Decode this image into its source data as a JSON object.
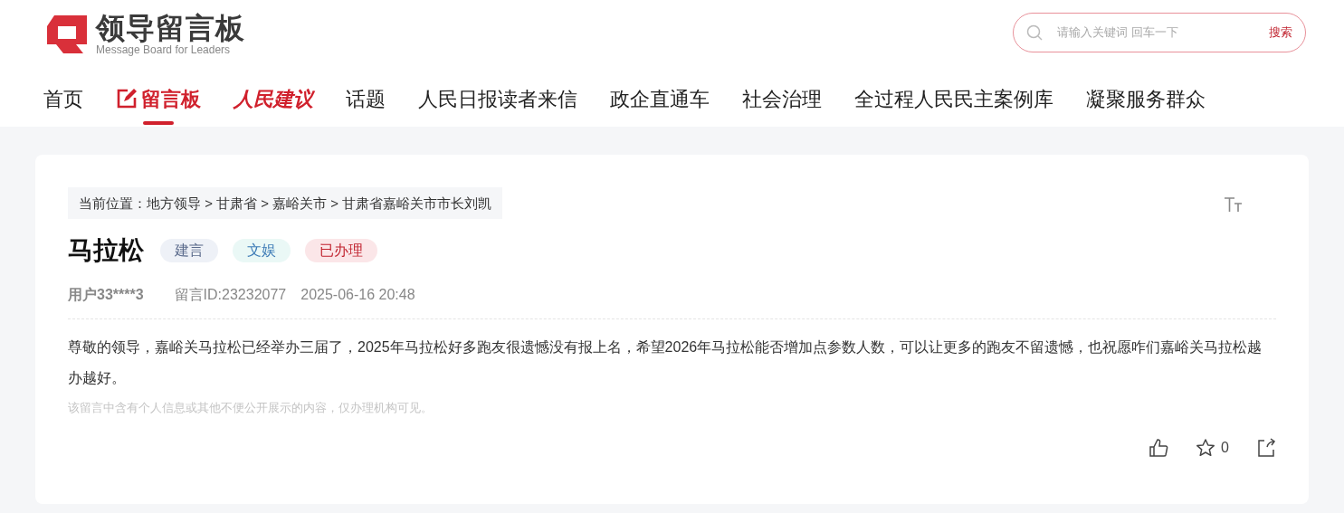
{
  "logo": {
    "title": "领导留言板",
    "subtitle": "Message Board for Leaders"
  },
  "search": {
    "placeholder": "请输入关键词 回车一下",
    "button": "搜索"
  },
  "nav": [
    {
      "label": "首页",
      "kind": "plain",
      "selected": false
    },
    {
      "label": "留言板",
      "kind": "icon",
      "selected": true
    },
    {
      "label": "人民建议",
      "kind": "brand",
      "selected": false
    },
    {
      "label": "话题",
      "kind": "plain",
      "selected": false
    },
    {
      "label": "人民日报读者来信",
      "kind": "plain",
      "selected": false
    },
    {
      "label": "政企直通车",
      "kind": "plain",
      "selected": false
    },
    {
      "label": "社会治理",
      "kind": "plain",
      "selected": false
    },
    {
      "label": "全过程人民民主案例库",
      "kind": "plain",
      "selected": false
    },
    {
      "label": "凝聚服务群众",
      "kind": "plain",
      "selected": false
    }
  ],
  "breadcrumb": "当前位置：地方领导 > 甘肃省 > 嘉峪关市 > 甘肃省嘉峪关市市长刘凯",
  "post": {
    "title": "马拉松",
    "tags": [
      {
        "label": "建言",
        "color": "#eef1f7"
      },
      {
        "label": "文娱",
        "color": "#eaf8f6"
      },
      {
        "label": "已办理",
        "color": "#fbe6e8"
      }
    ],
    "user": "用户33****3",
    "message_id": "留言ID:23232077",
    "time": "2025-06-16 20:48",
    "body": "尊敬的领导，嘉峪关马拉松已经举办三届了，2025年马拉松好多跑友很遗憾没有报上名，希望2026年马拉松能否增加点参数人数，可以让更多的跑友不留遗憾，也祝愿咋们嘉峪关马拉松越办越好。",
    "notice": "该留言中含有个人信息或其他不便公开展示的内容，仅办理机构可见。",
    "favorites": "0"
  }
}
